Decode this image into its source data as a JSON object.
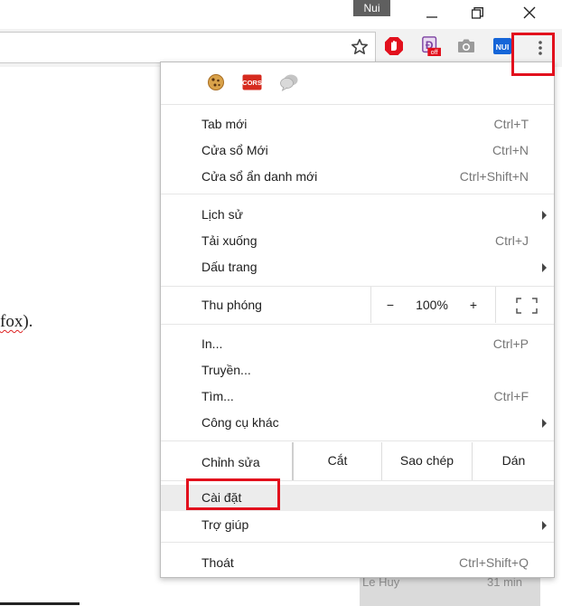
{
  "window": {
    "profile_badge": "Nui",
    "controls": [
      "minimize-icon",
      "restore-icon",
      "close-icon"
    ]
  },
  "toolbar": {
    "bookmark_icon": "star-icon",
    "extensions": [
      {
        "name": "adblock-icon",
        "color": "#e2101d"
      },
      {
        "name": "dict-off-icon",
        "badge": "off",
        "color": "#7a3fa0"
      },
      {
        "name": "camera-icon",
        "color": "#9a9a9a"
      },
      {
        "name": "nui-extension-icon",
        "label": "NUI",
        "color": "#1565d8"
      }
    ],
    "menu_icon": "more-vertical-icon"
  },
  "page": {
    "text_word": "fox",
    "text_tail": ")."
  },
  "background": {
    "left": "Le Huy",
    "right": "31 min"
  },
  "menu": {
    "extension_icons": [
      {
        "name": "cookie-icon",
        "color": "#c98a2e"
      },
      {
        "name": "cors-icon",
        "label": "CORS",
        "color": "#d62b1f"
      },
      {
        "name": "chat-bubbles-icon",
        "color": "#b8b8b8"
      }
    ],
    "new_tab": {
      "label": "Tab mới",
      "shortcut": "Ctrl+T"
    },
    "new_window": {
      "label": "Cửa sổ Mới",
      "shortcut": "Ctrl+N"
    },
    "incognito": {
      "label": "Cửa sổ ẩn danh mới",
      "shortcut": "Ctrl+Shift+N"
    },
    "history": {
      "label": "Lịch sử"
    },
    "downloads": {
      "label": "Tải xuống",
      "shortcut": "Ctrl+J"
    },
    "bookmarks": {
      "label": "Dấu trang"
    },
    "zoom": {
      "label": "Thu phóng",
      "minus": "−",
      "value": "100%",
      "plus": "+"
    },
    "print": {
      "label": "In...",
      "shortcut": "Ctrl+P"
    },
    "cast": {
      "label": "Truyền..."
    },
    "find": {
      "label": "Tìm...",
      "shortcut": "Ctrl+F"
    },
    "more_tools": {
      "label": "Công cụ khác"
    },
    "edit": {
      "label": "Chỉnh sửa",
      "cut": "Cắt",
      "copy": "Sao chép",
      "paste": "Dán"
    },
    "settings": {
      "label": "Cài đặt"
    },
    "help": {
      "label": "Trợ giúp"
    },
    "exit": {
      "label": "Thoát",
      "shortcut": "Ctrl+Shift+Q"
    }
  },
  "colors": {
    "highlight_box": "#e2101d",
    "hover_row": "#ececec"
  }
}
